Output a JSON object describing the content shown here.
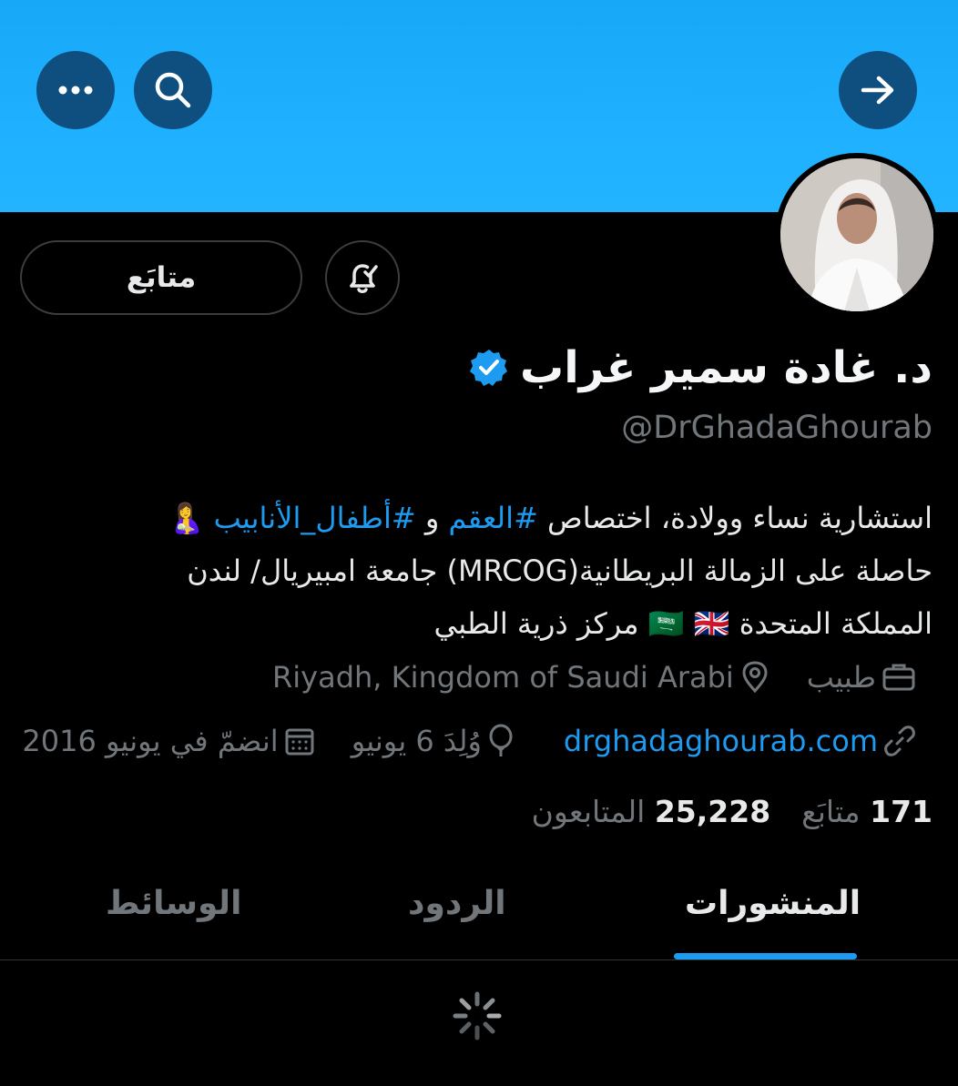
{
  "header": {
    "back_icon": "arrow-right-icon",
    "search_icon": "search-icon",
    "more_icon": "more-dots-icon"
  },
  "profile": {
    "follow_label": "متابَع",
    "name": "د. غادة سمير غراب",
    "verified": true,
    "handle": "@DrGhadaGhourab",
    "bio": {
      "line1_pre": "استشارية نساء وولادة، اختصاص ",
      "tag1": "#العقم",
      "line1_mid": " و ",
      "tag2": "#أطفال_الأنابيب",
      "line1_emoji": " 🤱",
      "line2": "حاصلة على الزمالة البريطانية(MRCOG) جامعة امبيريال/ لندن",
      "line3": "المملكة المتحدة 🇸🇦 🇬🇧 مركز ذرية الطبي"
    },
    "profession": "طبيب",
    "location": "Riyadh, Kingdom of Saudi Arabi",
    "website": "drghadaghourab.com",
    "birthday": "وُلِدَ 6 يونيو",
    "joined": "انضمّ في يونيو 2016",
    "following_count": "171",
    "following_label": "متابَع",
    "followers_count": "25,228",
    "followers_label": "المتابعون"
  },
  "tabs": [
    {
      "label": "المنشورات",
      "active": true
    },
    {
      "label": "الردود",
      "active": false
    },
    {
      "label": "الوسائط",
      "active": false
    }
  ],
  "colors": {
    "banner": "#1fb0ff",
    "accent": "#1d9bf0",
    "muted": "#71767b",
    "button_bg": "#0f4f80"
  }
}
